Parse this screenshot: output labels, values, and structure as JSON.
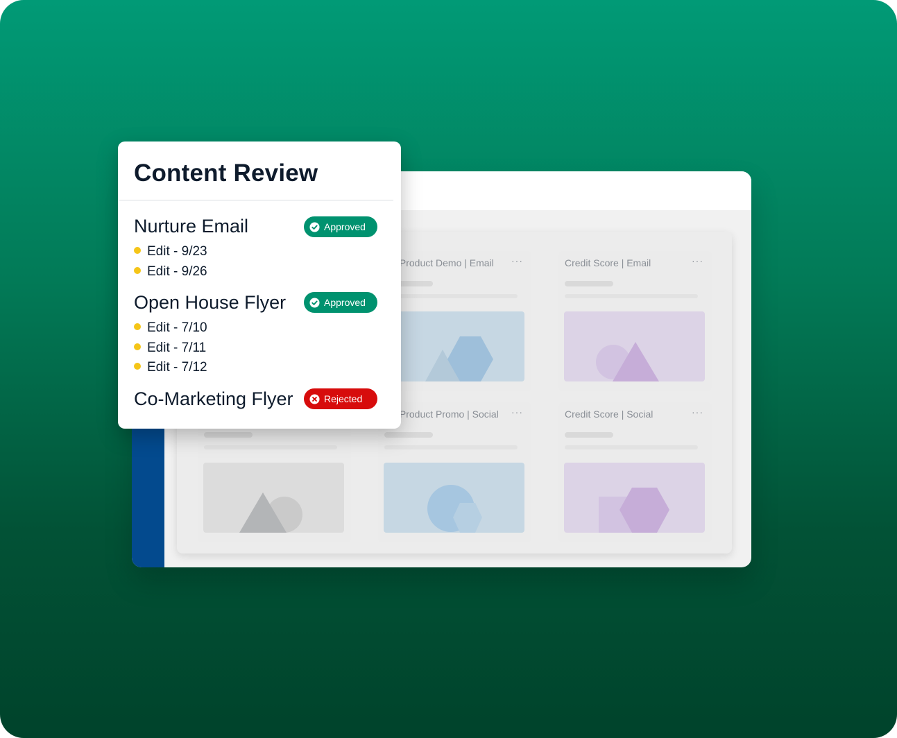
{
  "panel": {
    "title": "Content Review",
    "items": [
      {
        "name": "Nurture Email",
        "status": "Approved",
        "status_icon": "check-circle-icon",
        "edits": [
          "Edit - 9/23",
          "Edit - 9/26"
        ]
      },
      {
        "name": "Open House Flyer",
        "status": "Approved",
        "status_icon": "check-circle-icon",
        "edits": [
          "Edit - 7/10",
          "Edit - 7/11",
          "Edit - 7/12"
        ]
      },
      {
        "name": "Co-Marketing Flyer",
        "status": "Rejected",
        "status_icon": "x-circle-icon",
        "edits": []
      }
    ]
  },
  "board": {
    "cards": [
      {
        "title": "v Product Demo | Email",
        "menu": "···",
        "thumb_color": "#c6d7e3"
      },
      {
        "title": "Credit Score | Email",
        "menu": "···",
        "thumb_color": "#dcd3e6"
      },
      {
        "title": "",
        "menu": "",
        "thumb_color": "#dcdcdc"
      },
      {
        "title": "v Product Promo | Social",
        "menu": "···",
        "thumb_color": "#c6d7e3"
      },
      {
        "title": "Credit Score | Social",
        "menu": "···",
        "thumb_color": "#dcd3e6"
      }
    ]
  },
  "colors": {
    "approved": "#00926f",
    "rejected": "#d70c0c",
    "edit_dot": "#f5c518",
    "sidebar": "#034a8e"
  }
}
